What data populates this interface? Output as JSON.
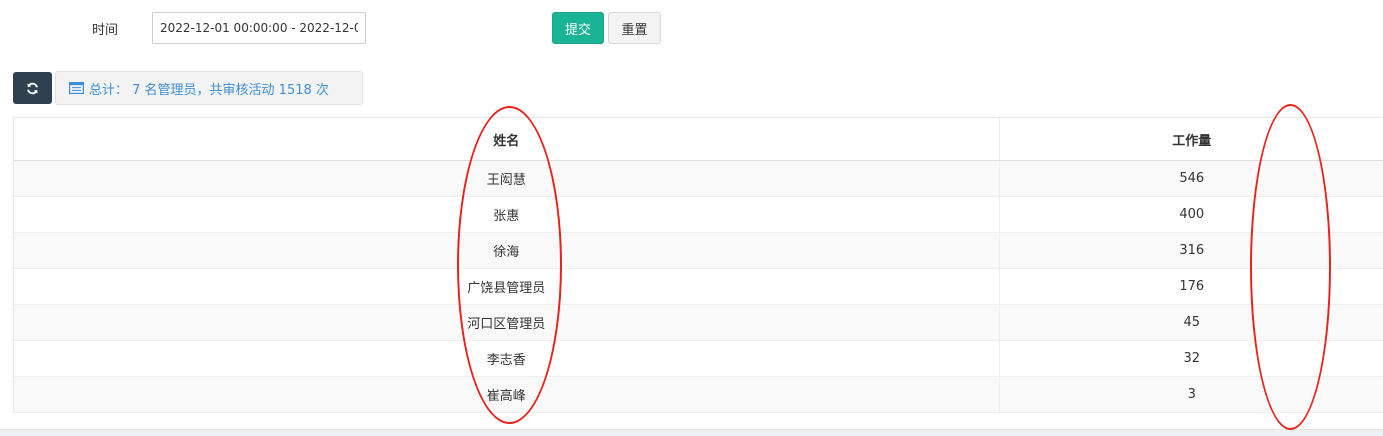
{
  "filter": {
    "time_label": "时间",
    "time_range_value": "2022-12-01 00:00:00 - 2022-12-0",
    "submit_label": "提交",
    "reset_label": "重置"
  },
  "toolbar": {
    "refresh_icon": "refresh-icon",
    "summary_icon": "list-icon",
    "summary_text": "总计： 7 名管理员，共审核活动 1518 次"
  },
  "table": {
    "headers": [
      "姓名",
      "工作量"
    ],
    "rows": [
      {
        "name": "王闳慧",
        "workload": "546"
      },
      {
        "name": "张惠",
        "workload": "400"
      },
      {
        "name": "徐海",
        "workload": "316"
      },
      {
        "name": "广饶县管理员",
        "workload": "176"
      },
      {
        "name": "河口区管理员",
        "workload": "45"
      },
      {
        "name": "李志香",
        "workload": "32"
      },
      {
        "name": "崔高峰",
        "workload": "3"
      }
    ]
  },
  "colors": {
    "submit_bg": "#1ab394",
    "refresh_bg": "#2f4050",
    "summary_text": "#3f8fd6",
    "annotation": "#e8231c"
  }
}
